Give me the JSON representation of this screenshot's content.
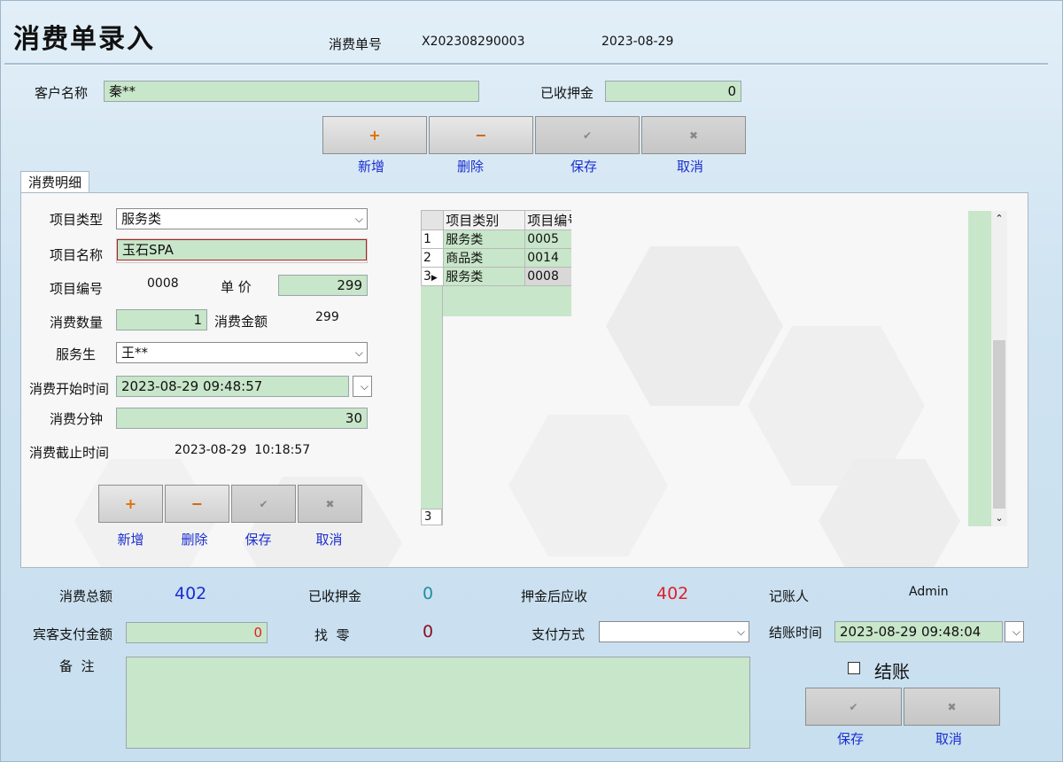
{
  "title": "消费单录入",
  "header": {
    "order_no_label": "消费单号",
    "order_no": "X202308290003",
    "date": "2023-08-29"
  },
  "customer": {
    "name_label": "客户名称",
    "name": "秦**",
    "deposit_label": "已收押金",
    "deposit": "0"
  },
  "top_toolbar": {
    "add": "新增",
    "delete": "删除",
    "save": "保存",
    "cancel": "取消"
  },
  "tab_label": "消费明细",
  "detail": {
    "item_type_label": "项目类型",
    "item_type": "服务类",
    "item_name_label": "项目名称",
    "item_name": "玉石SPA",
    "item_code_label": "项目编号",
    "item_code": "0008",
    "unit_price_label": "单  价",
    "unit_price": "299",
    "qty_label": "消费数量",
    "qty": "1",
    "amount_label": "消费金额",
    "amount": "299",
    "waiter_label": "服务生",
    "waiter": "王**",
    "start_label": "消费开始时间",
    "start": "2023-08-29 09:48:57",
    "minutes_label": "消费分钟",
    "minutes": "30",
    "end_label": "消费截止时间",
    "end": "2023-08-29  10:18:57"
  },
  "detail_toolbar": {
    "add": "新增",
    "delete": "删除",
    "save": "保存",
    "cancel": "取消"
  },
  "grid": {
    "headers": [
      "项目类别",
      "项目编号"
    ],
    "rows": [
      {
        "num": "1",
        "category": "服务类",
        "code": "0005"
      },
      {
        "num": "2",
        "category": "商品类",
        "code": "0014"
      },
      {
        "num": "3",
        "category": "服务类",
        "code": "0008"
      }
    ],
    "row_count": "3"
  },
  "summary": {
    "total_label": "消费总额",
    "total": "402",
    "deposit_label": "已收押金",
    "deposit": "0",
    "due_label": "押金后应收",
    "due": "402",
    "bookkeeper_label": "记账人",
    "bookkeeper": "Admin",
    "paid_label": "宾客支付金额",
    "paid": "0",
    "change_label": "找  零",
    "change": "0",
    "pay_method_label": "支付方式",
    "pay_method": "",
    "checkout_time_label": "结账时间",
    "checkout_time": "2023-08-29 09:48:04",
    "remark_label": "备  注",
    "remark": "",
    "settle_label": "结账"
  },
  "bottom_toolbar": {
    "save": "保存",
    "cancel": "取消"
  },
  "colors": {
    "field_green": "#c8e6c9",
    "blue_value": "#1a2ecf",
    "teal_value": "#1f8fa0",
    "red_value": "#e0202a",
    "dark_red_value": "#8a1020"
  }
}
